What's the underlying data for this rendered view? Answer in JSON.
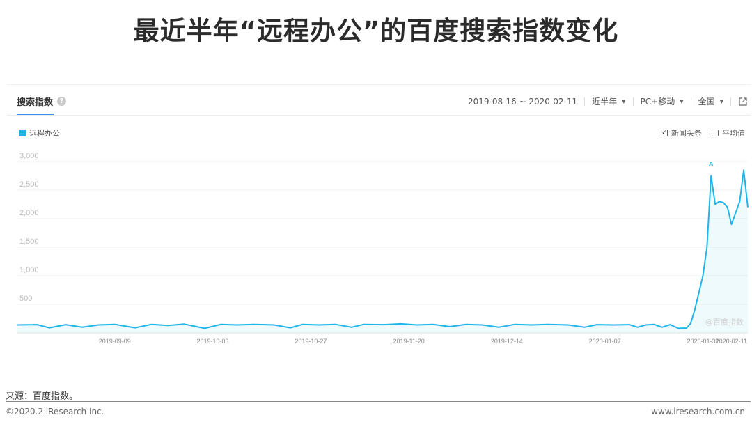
{
  "title": "最近半年“远程办公”的百度搜索指数变化",
  "tab": {
    "label": "搜索指数",
    "help_icon": "?"
  },
  "toolbar": {
    "date_range": "2019-08-16 ~ 2020-02-11",
    "period": "近半年",
    "device": "PC+移动",
    "region": "全国",
    "caret": "▼"
  },
  "legend": {
    "series_name": "远程办公",
    "color": "#1fb5e8"
  },
  "options": {
    "news_label": "新闻头条",
    "news_checked": true,
    "avg_label": "平均值",
    "avg_checked": false
  },
  "watermark": "@百度指数",
  "source": "来源：百度指数。",
  "copyright": "©2020.2 iResearch Inc.",
  "website": "www.iresearch.com.cn",
  "chart_data": {
    "type": "area",
    "x_start": "2019-08-16",
    "x_end": "2020-02-11",
    "xtick_labels": [
      "2019-09-09",
      "2019-10-03",
      "2019-10-27",
      "2019-11-20",
      "2019-12-14",
      "2020-01-07",
      "2020-01-31",
      "2020-02-11"
    ],
    "ytick_labels": [
      "500",
      "1,000",
      "1,500",
      "2,000",
      "2,500",
      "3,000"
    ],
    "ylim": [
      0,
      3000
    ],
    "grid": true,
    "annotation": {
      "label": "A",
      "date": "2020-02-02"
    },
    "series": [
      {
        "name": "远程办公",
        "points": [
          [
            "2019-08-16",
            140
          ],
          [
            "2019-08-21",
            145
          ],
          [
            "2019-08-24",
            90
          ],
          [
            "2019-08-28",
            145
          ],
          [
            "2019-09-01",
            100
          ],
          [
            "2019-09-05",
            140
          ],
          [
            "2019-09-09",
            150
          ],
          [
            "2019-09-14",
            90
          ],
          [
            "2019-09-18",
            150
          ],
          [
            "2019-09-22",
            130
          ],
          [
            "2019-09-26",
            155
          ],
          [
            "2019-10-01",
            80
          ],
          [
            "2019-10-05",
            150
          ],
          [
            "2019-10-09",
            140
          ],
          [
            "2019-10-13",
            150
          ],
          [
            "2019-10-18",
            140
          ],
          [
            "2019-10-22",
            90
          ],
          [
            "2019-10-25",
            150
          ],
          [
            "2019-10-29",
            140
          ],
          [
            "2019-11-02",
            150
          ],
          [
            "2019-11-06",
            100
          ],
          [
            "2019-11-09",
            150
          ],
          [
            "2019-11-14",
            145
          ],
          [
            "2019-11-18",
            160
          ],
          [
            "2019-11-22",
            140
          ],
          [
            "2019-11-26",
            150
          ],
          [
            "2019-11-30",
            110
          ],
          [
            "2019-12-04",
            150
          ],
          [
            "2019-12-08",
            140
          ],
          [
            "2019-12-12",
            100
          ],
          [
            "2019-12-16",
            150
          ],
          [
            "2019-12-20",
            140
          ],
          [
            "2019-12-24",
            150
          ],
          [
            "2019-12-29",
            140
          ],
          [
            "2020-01-02",
            100
          ],
          [
            "2020-01-05",
            145
          ],
          [
            "2020-01-09",
            140
          ],
          [
            "2020-01-13",
            145
          ],
          [
            "2020-01-15",
            100
          ],
          [
            "2020-01-17",
            140
          ],
          [
            "2020-01-19",
            150
          ],
          [
            "2020-01-21",
            100
          ],
          [
            "2020-01-23",
            145
          ],
          [
            "2020-01-25",
            80
          ],
          [
            "2020-01-27",
            85
          ],
          [
            "2020-01-28",
            170
          ],
          [
            "2020-01-29",
            400
          ],
          [
            "2020-01-30",
            700
          ],
          [
            "2020-01-31",
            1000
          ],
          [
            "2020-02-01",
            1500
          ],
          [
            "2020-02-02",
            2750
          ],
          [
            "2020-02-03",
            2250
          ],
          [
            "2020-02-04",
            2300
          ],
          [
            "2020-02-05",
            2280
          ],
          [
            "2020-02-06",
            2200
          ],
          [
            "2020-02-07",
            1900
          ],
          [
            "2020-02-08",
            2100
          ],
          [
            "2020-02-09",
            2300
          ],
          [
            "2020-02-10",
            2850
          ],
          [
            "2020-02-11",
            2200
          ]
        ]
      }
    ]
  }
}
